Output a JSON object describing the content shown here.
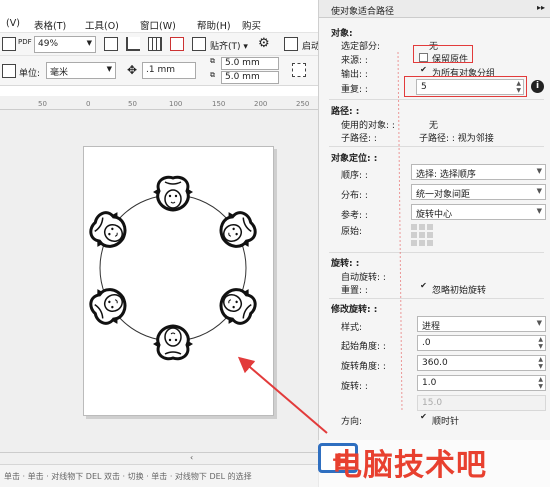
{
  "menubar": {
    "items": [
      "(V)",
      "表格(T)",
      "工具(O)",
      "窗口(W)",
      "帮助(H)",
      "购买"
    ]
  },
  "toolbar": {
    "zoom": "49%",
    "snap_label": "贴齐(T)",
    "launch_label": "启动",
    "unit_label": "单位:",
    "unit_value": "毫米",
    "nudge_value": ".1 mm",
    "dup_x": "5.0 mm",
    "dup_y": "5.0 mm"
  },
  "ruler": {
    "ticks": [
      "50",
      "0",
      "50",
      "100",
      "150",
      "200",
      "250"
    ]
  },
  "statusbar": {
    "text": "单击 · 单击 · 对线物下 DEL 双击 · 切换 · 单击 · 对线物下 DEL 的选择"
  },
  "docker": {
    "title": "使对象适合路径",
    "object": {
      "heading": "对象:",
      "selected_part_label": "选定部分:",
      "selected_part_value": "无",
      "source_label": "来源: :",
      "keep_original_label": "保留原件",
      "keep_original_checked": false,
      "output_label": "输出: :",
      "group_label": "为所有对象分组",
      "group_checked": true,
      "repeat_label": "重复: :",
      "repeat_value": "5"
    },
    "path": {
      "heading": "路径: :",
      "used_object_label": "使用的对象: :",
      "used_object_value": "无",
      "subpath_label": "子路径: :",
      "subpath_value": "子路径: : 视为邻接"
    },
    "positioning": {
      "heading": "对象定位: :",
      "order_label": "顺序: :",
      "order_value": "选择: 选择顺序",
      "distribution_label": "分布: :",
      "distribution_value": "统一对象间距",
      "reference_label": "参考: :",
      "reference_value": "旋转中心",
      "origin_label": "原始:"
    },
    "rotation": {
      "heading": "旋转: :",
      "auto_label": "自动旋转: :",
      "reset_label": "重置: :",
      "ignore_initial_label": "忽略初始旋转",
      "ignore_initial_checked": true
    },
    "modify_rotation": {
      "heading": "修改旋转: :",
      "style_label": "样式:",
      "style_value": "进程",
      "start_angle_label": "起始角度: :",
      "start_angle_value": ".0",
      "rotate_angle_label": "旋转角度: :",
      "rotate_angle_value": "360.0",
      "rotate_label": "旋转: :",
      "rotate_value": "1.0",
      "disabled_value": "15.0",
      "direction_label": "方向:",
      "clockwise_label": "顺时针",
      "clockwise_checked": true
    }
  },
  "watermark": {
    "text": "电脑技术吧"
  },
  "colors": {
    "annotation_red": "#e23b3b",
    "watermark_red": "#e8402f",
    "watermark_blue": "#2f6fc0"
  }
}
